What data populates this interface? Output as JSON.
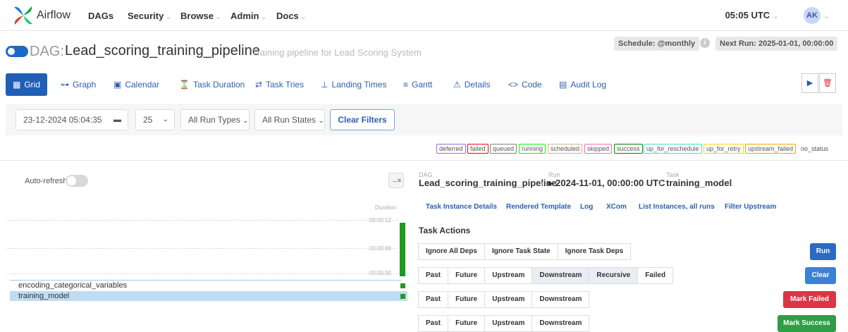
{
  "nav": {
    "brand": "Airflow",
    "items": [
      "DAGs",
      "Security",
      "Browse",
      "Admin",
      "Docs"
    ],
    "time": "05:05 UTC",
    "avatar": "AK"
  },
  "dag": {
    "prefix": "DAG:",
    "name": "Lead_scoring_training_pipeline",
    "description": "Training pipeline for Lead Scoring System",
    "schedule": "Schedule: @monthly",
    "next_run": "Next Run: 2025-01-01, 00:00:00"
  },
  "tabs": [
    "Grid",
    "Graph",
    "Calendar",
    "Task Duration",
    "Task Tries",
    "Landing Times",
    "Gantt",
    "Details",
    "Code",
    "Audit Log"
  ],
  "filters": {
    "date": "23-12-2024 05:04:35",
    "count": "25",
    "run_types": "All Run Types",
    "run_states": "All Run States",
    "clear": "Clear Filters"
  },
  "legend": [
    "deferred",
    "failed",
    "queued",
    "running",
    "scheduled",
    "skipped",
    "success",
    "up_for_reschedule",
    "up_for_retry",
    "upstream_failed",
    "no_status"
  ],
  "colors": {
    "accent": "#1f5fb5",
    "success": "#1e9b1e",
    "danger": "#dc3545",
    "run_btn": "#2b6bc2",
    "clear_btn": "#3b82d6",
    "mark_success": "#2f9e44",
    "legend_borders": [
      "#9370db",
      "#ff0000",
      "#808080",
      "#00ff00",
      "#d2b48c",
      "#ff69b4",
      "#008000",
      "#40e0d0",
      "#ffd700",
      "#ffa500",
      "#ffffff"
    ]
  },
  "grid": {
    "autorefresh": "Auto-refresh",
    "duration_label": "Duration",
    "ticks": [
      "00:00:12",
      "00:00:06",
      "00:00:00"
    ],
    "tasks": [
      "encoding_categorical_variables",
      "training_model"
    ]
  },
  "detail": {
    "dag_label": "DAG",
    "dag_value": "Lead_scoring_training_pipeline",
    "run_label": "Run",
    "run_value": "▸ 2024-11-01, 00:00:00 UTC",
    "task_label": "Task",
    "task_value": "training_model",
    "subtabs": [
      "Task Instance Details",
      "Rendered Template",
      "Log",
      "XCom",
      "List Instances, all runs",
      "Filter Upstream"
    ],
    "actions_title": "Task Actions",
    "run_opts": [
      "Ignore All Deps",
      "Ignore Task State",
      "Ignore Task Deps"
    ],
    "clear_opts": [
      "Past",
      "Future",
      "Upstream",
      "Downstream",
      "Recursive",
      "Failed"
    ],
    "mark_opts": [
      "Past",
      "Future",
      "Upstream",
      "Downstream"
    ],
    "btn_run": "Run",
    "btn_clear": "Clear",
    "btn_failed": "Mark Failed",
    "btn_success": "Mark Success"
  }
}
